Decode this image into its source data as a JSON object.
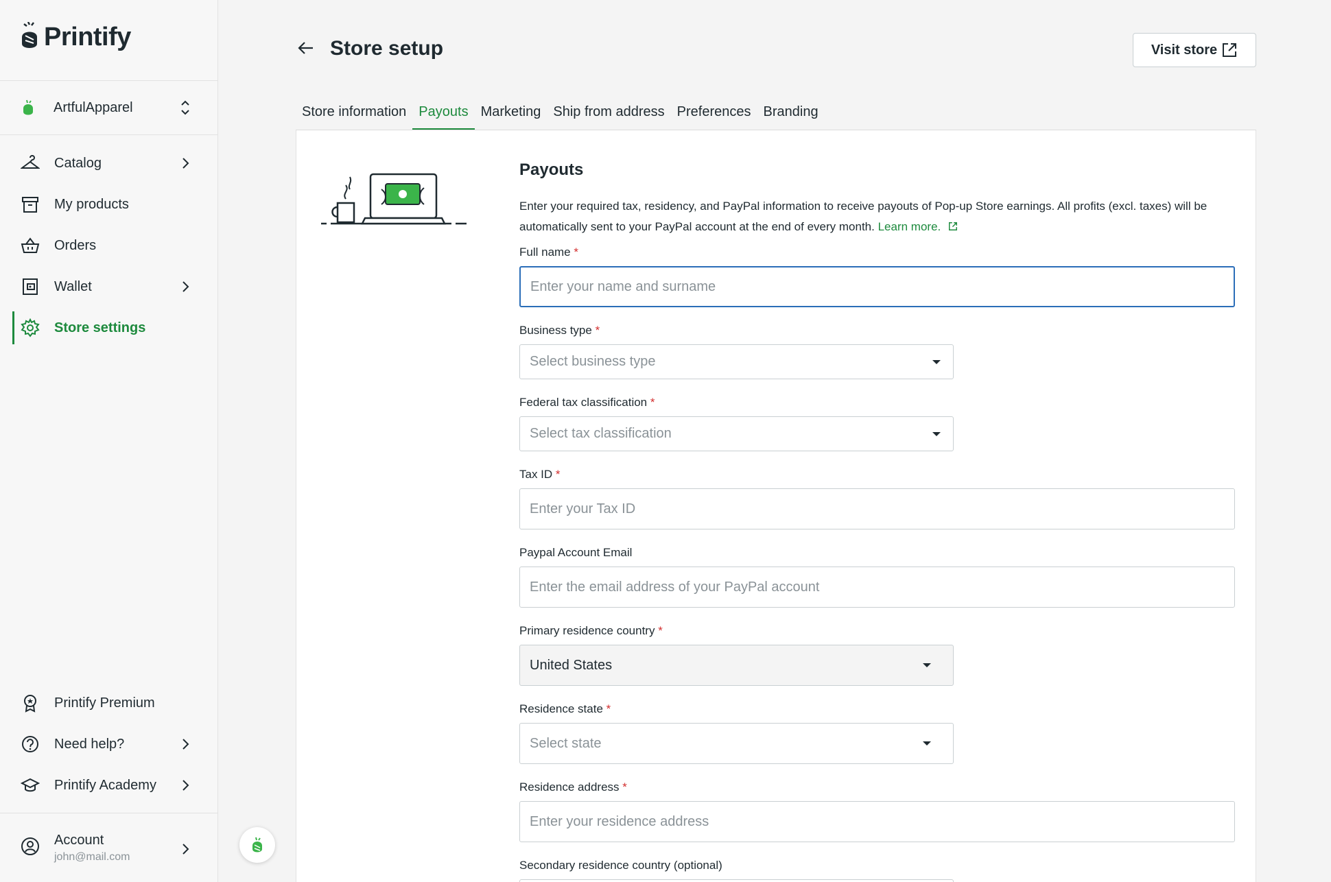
{
  "brand": {
    "name": "Printify",
    "accent": "#1d8a3d"
  },
  "store": {
    "name": "ArtfulApparel"
  },
  "nav": {
    "items": [
      {
        "label": "Catalog",
        "icon": "hanger-icon",
        "chevron": true
      },
      {
        "label": "My products",
        "icon": "box-icon",
        "chevron": false
      },
      {
        "label": "Orders",
        "icon": "basket-icon",
        "chevron": false
      },
      {
        "label": "Wallet",
        "icon": "wallet-icon",
        "chevron": true
      },
      {
        "label": "Store settings",
        "icon": "gear-icon",
        "chevron": false,
        "active": true
      }
    ],
    "bottom": [
      {
        "label": "Printify Premium",
        "icon": "badge-icon"
      },
      {
        "label": "Need help?",
        "icon": "help-icon"
      },
      {
        "label": "Printify Academy",
        "icon": "graduation-cap-icon"
      }
    ],
    "account": {
      "label": "Account",
      "email": "john@mail.com"
    }
  },
  "header": {
    "title": "Store setup",
    "visit_store": "Visit store"
  },
  "tabs": [
    "Store information",
    "Payouts",
    "Marketing",
    "Ship from address",
    "Preferences",
    "Branding"
  ],
  "active_tab": "Payouts",
  "payouts": {
    "title": "Payouts",
    "description": "Enter your required tax, residency, and PayPal information to receive payouts of Pop-up Store earnings. All profits (excl. taxes) will be automatically sent to your PayPal account at the end of every month.",
    "learn_more": "Learn more.",
    "fields": {
      "full_name": {
        "label": "Full name",
        "placeholder": "Enter your name and surname"
      },
      "business_type": {
        "label": "Business type",
        "placeholder": "Select business type"
      },
      "tax_classification": {
        "label": "Federal tax classification",
        "placeholder": "Select tax classification"
      },
      "tax_id": {
        "label": "Tax ID",
        "placeholder": "Enter your Tax ID"
      },
      "paypal_email": {
        "label": "Paypal Account Email",
        "placeholder": "Enter the email address of your PayPal account"
      },
      "residence_country": {
        "label": "Primary residence country",
        "value": "United States"
      },
      "residence_state": {
        "label": "Residence state",
        "placeholder": "Select state"
      },
      "residence_address": {
        "label": "Residence address",
        "placeholder": "Enter your residence address"
      },
      "secondary_country": {
        "label": "Secondary residence country (optional)"
      }
    },
    "required_mark": "*"
  }
}
